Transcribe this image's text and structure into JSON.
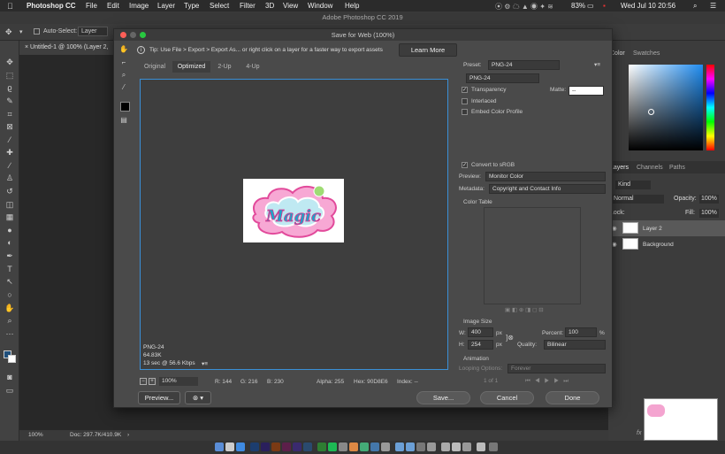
{
  "menubar": {
    "apple": "",
    "app": "Photoshop CC",
    "items": [
      "File",
      "Edit",
      "Image",
      "Layer",
      "Type",
      "Select",
      "Filter",
      "3D",
      "View",
      "Window",
      "Help"
    ],
    "battery": "83%",
    "datetime": "Wed Jul 10  20:56"
  },
  "window_title": "Adobe Photoshop CC 2019",
  "options": {
    "auto_select": "Auto-Select:",
    "auto_select_value": "Layer"
  },
  "document_tab": "Untitled-1 @ 100% (Layer 2,",
  "status": {
    "zoom": "100%",
    "doc": "Doc: 297.7K/410.9K"
  },
  "dialog": {
    "title": "Save for Web (100%)",
    "tip": "Tip: Use File > Export > Export As...  or right click on a layer for a faster way to export assets",
    "learn_more": "Learn More",
    "tabs": [
      "Original",
      "Optimized",
      "2-Up",
      "4-Up"
    ],
    "preview_info": {
      "format": "PNG-24",
      "size": "64.83K",
      "time": "13 sec @ 56.6 Kbps"
    },
    "bottom": {
      "zoom": "100%",
      "r": "R: 144",
      "g": "G: 216",
      "b": "B: 230",
      "alpha": "Alpha: 255",
      "hex": "Hex: 90D8E6",
      "index": "Index: --"
    },
    "settings": {
      "preset_label": "Preset:",
      "preset_value": "PNG-24",
      "format_value": "PNG-24",
      "transparency": "Transparency",
      "matte_label": "Matte:",
      "matte_value": "--",
      "interlaced": "Interlaced",
      "embed": "Embed Color Profile",
      "convert": "Convert to sRGB",
      "preview_label": "Preview:",
      "preview_value": "Monitor Color",
      "metadata_label": "Metadata:",
      "metadata_value": "Copyright and Contact Info",
      "color_table": "Color Table",
      "image_size": "Image Size",
      "w_label": "W:",
      "w_value": "400",
      "h_label": "H:",
      "h_value": "254",
      "px": "px",
      "percent_label": "Percent:",
      "percent_value": "100",
      "percent_unit": "%",
      "quality_label": "Quality:",
      "quality_value": "Bilinear",
      "animation": "Animation",
      "looping_label": "Looping Options:",
      "looping_value": "Forever",
      "frame": "1 of 1"
    },
    "buttons": {
      "preview": "Preview...",
      "save": "Save...",
      "cancel": "Cancel",
      "done": "Done"
    },
    "logo_text": "Magic"
  },
  "panels": {
    "color_tab": "Color",
    "swatches_tab": "Swatches",
    "layers_tab": "Layers",
    "channels_tab": "Channels",
    "paths_tab": "Paths",
    "kind": "Kind",
    "blend": "Normal",
    "opacity_label": "Opacity:",
    "opacity": "100%",
    "lock_label": "Lock:",
    "fill_label": "Fill:",
    "fill": "100%",
    "layers": [
      "Layer 2",
      "Background"
    ]
  }
}
